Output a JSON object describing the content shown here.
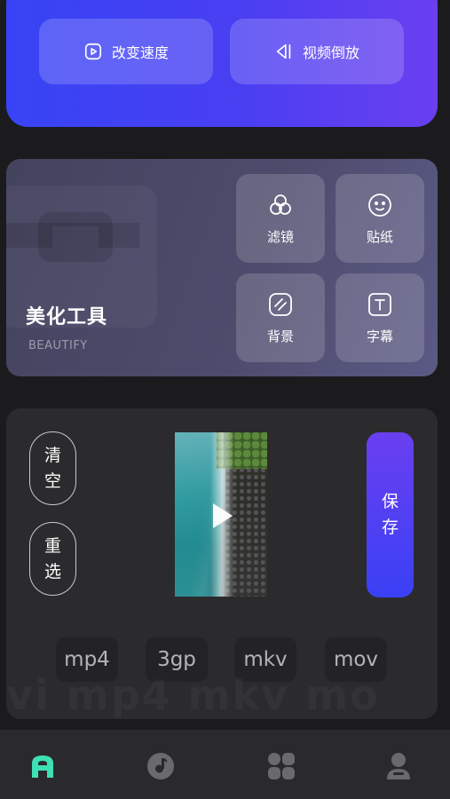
{
  "top_actions": {
    "change_speed_label": "改变速度",
    "reverse_video_label": "视频倒放"
  },
  "beautify": {
    "title": "美化工具",
    "subtitle": "BEAUTIFY",
    "tools": [
      {
        "label": "滤镜",
        "icon": "filter-icon"
      },
      {
        "label": "贴纸",
        "icon": "sticker-icon"
      },
      {
        "label": "背景",
        "icon": "background-icon"
      },
      {
        "label": "字幕",
        "icon": "subtitle-icon"
      }
    ]
  },
  "editor": {
    "clear_label": "清空",
    "reselect_label": "重选",
    "save_label": "保存",
    "formats": [
      "mp4",
      "3gp",
      "mkv",
      "mov"
    ],
    "ghost_text": "vi mp4 mkv mo"
  },
  "bottom_nav": [
    {
      "icon": "home-icon",
      "active": true
    },
    {
      "icon": "music-icon",
      "active": false
    },
    {
      "icon": "apps-icon",
      "active": false
    },
    {
      "icon": "profile-icon",
      "active": false
    }
  ],
  "colors": {
    "accent_blue": "#3744f5",
    "accent_purple": "#6a3ff0",
    "active_nav": "#3ee0b5",
    "inactive_nav": "#6a6a6e"
  }
}
